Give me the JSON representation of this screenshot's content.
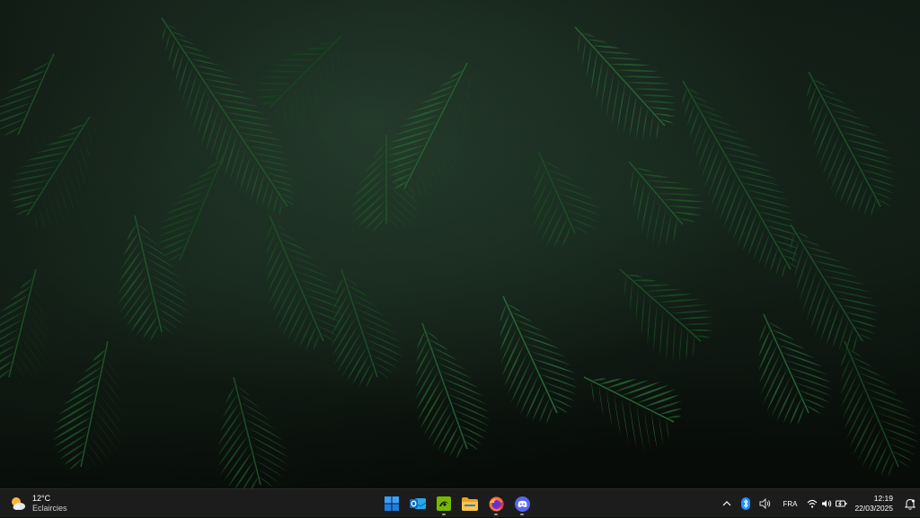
{
  "desktop": {
    "wallpaper": "dark tropical palm leaves"
  },
  "taskbar": {
    "weather": {
      "temperature": "12°C",
      "condition": "Eclaircies",
      "icon": "partly-cloudy-icon"
    },
    "apps": [
      {
        "name": "Start",
        "icon": "windows-start-icon",
        "running": false
      },
      {
        "name": "Outlook",
        "icon": "outlook-icon",
        "running": false
      },
      {
        "name": "NVIDIA",
        "icon": "nvidia-icon",
        "running": true
      },
      {
        "name": "File Explorer",
        "icon": "folder-icon",
        "running": false
      },
      {
        "name": "Firefox",
        "icon": "firefox-icon",
        "running": true
      },
      {
        "name": "Discord",
        "icon": "discord-icon",
        "running": true
      }
    ],
    "tray": {
      "language": "FRA",
      "time": "12:19",
      "date": "22/03/2025"
    }
  },
  "colors": {
    "taskbar_bg": "#1c1c1c",
    "accent_blue": "#1e90ff",
    "nvidia_green": "#76b900",
    "discord": "#5865f2"
  }
}
